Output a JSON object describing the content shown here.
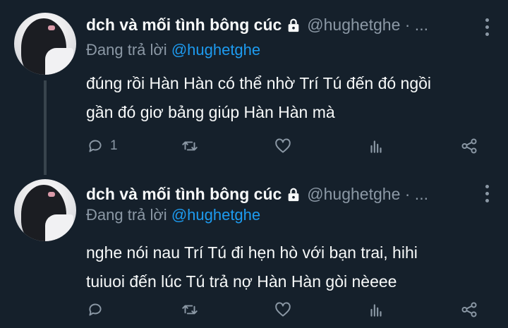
{
  "colors": {
    "background": "#15202b",
    "text": "#f7f9f9",
    "muted": "#8b98a5",
    "link": "#1d9bf0",
    "thread_line": "#38444d"
  },
  "tweets": [
    {
      "author_name": "dch và mối tình bông cúc",
      "handle": "@hughetghe · ...",
      "replying_prefix": "Đang trả lời ",
      "replying_to": "@hughetghe",
      "text_lines": [
        "đúng rồi Hàn Hàn có thể nhờ Trí Tú đến đó ngồi",
        "gần đó giơ bảng giúp Hàn Hàn mà"
      ],
      "reply_count": "1",
      "icons": [
        "reply-icon",
        "retweet-icon",
        "like-icon",
        "analytics-icon",
        "share-icon"
      ]
    },
    {
      "author_name": "dch và mối tình bông cúc",
      "handle": "@hughetghe · ...",
      "replying_prefix": "Đang trả lời ",
      "replying_to": "@hughetghe",
      "text_lines": [
        "nghe nói nau Trí Tú đi hẹn hò với bạn trai, hihi",
        "tuiuoi đến lúc Tú trả nợ Hàn Hàn gòi nèeee"
      ],
      "reply_count": "",
      "icons": [
        "reply-icon",
        "retweet-icon",
        "like-icon",
        "analytics-icon",
        "share-icon"
      ]
    }
  ]
}
